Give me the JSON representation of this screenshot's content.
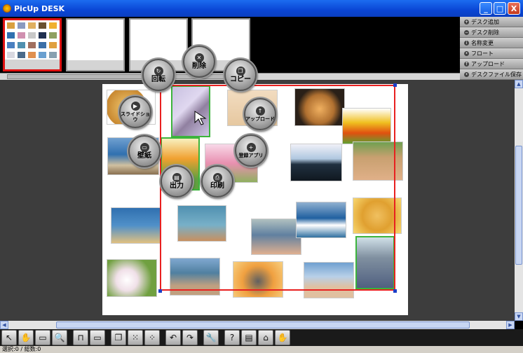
{
  "window": {
    "title": "PicUp DESK",
    "min": "_",
    "max": "□",
    "close": "X"
  },
  "side_panel": [
    {
      "icon": "add-icon",
      "label": "デスク追加"
    },
    {
      "icon": "minus-icon",
      "label": "デスク削除"
    },
    {
      "icon": "info-icon",
      "label": "名称変更"
    },
    {
      "icon": "float-icon",
      "label": "フロート"
    },
    {
      "icon": "upload-icon",
      "label": "アップロード"
    },
    {
      "icon": "save-icon",
      "label": "デスクファイル保存"
    }
  ],
  "radial_menu": {
    "rotate": "回転",
    "delete": "削除",
    "copy": "コピー",
    "slideshow": "スライドショウ",
    "upload": "アップロード",
    "wallpaper": "壁紙",
    "register_app": "登録アプリ",
    "output": "出力",
    "print": "印刷"
  },
  "status": {
    "text": "選択:0 / 総数:0"
  },
  "colors": {
    "selection": "#e82020",
    "titlebar": "#0a46d4",
    "handle": "#1b3fc7",
    "selected_photo": "#3cb43c"
  }
}
